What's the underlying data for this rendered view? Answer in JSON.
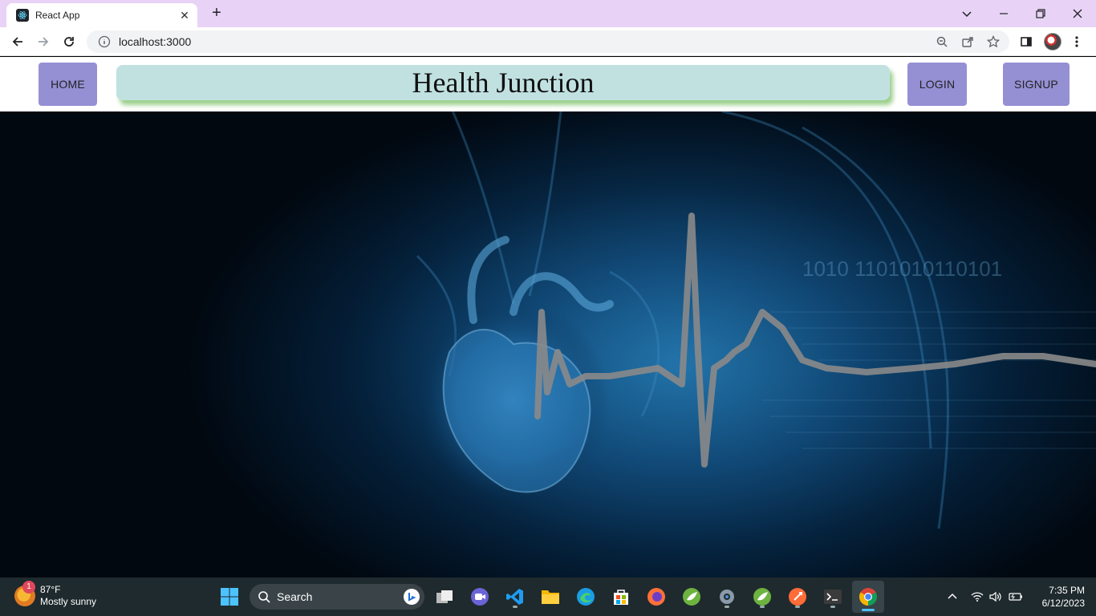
{
  "browser": {
    "tab_title": "React App",
    "url": "localhost:3000",
    "tab_close": "✕",
    "new_tab": "+"
  },
  "nav": {
    "home": "HOME",
    "brand": "Health Junction",
    "login": "LOGIN",
    "signup": "SIGNUP"
  },
  "hero": {
    "binary_text": "1010  1101010110101"
  },
  "taskbar": {
    "weather_temp": "87°F",
    "weather_desc": "Mostly sunny",
    "weather_badge": "1",
    "search_placeholder": "Search",
    "time": "7:35 PM",
    "date": "6/12/2023"
  },
  "colors": {
    "tabbar_bg": "#e8d3f7",
    "nav_button": "#9590d4",
    "brand_bg": "#c1e1e1",
    "brand_shadow": "#9ccf8c",
    "ecg_line": "#8a8a8a"
  }
}
